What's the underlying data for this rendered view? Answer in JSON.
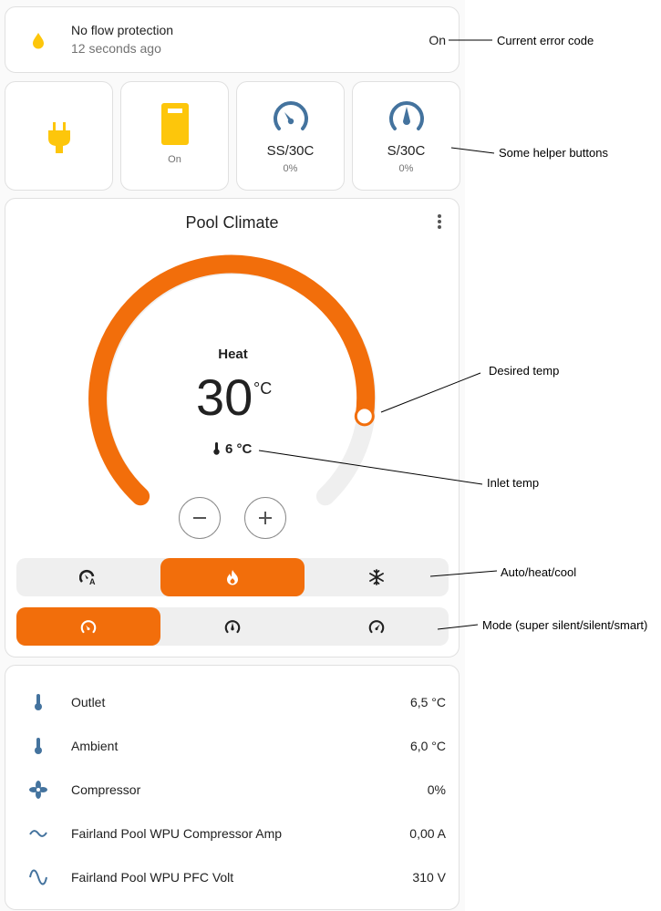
{
  "error_card": {
    "title": "No flow protection",
    "subtitle": "12 seconds ago",
    "state": "On",
    "icon": "water-drop-icon"
  },
  "helpers": [
    {
      "icon": "power-plug-icon",
      "name": "",
      "state": ""
    },
    {
      "icon": "switch-toggle-icon",
      "name": "",
      "state": "On"
    },
    {
      "icon": "gauge-low-icon",
      "name": "SS/30C",
      "state": "0%"
    },
    {
      "icon": "gauge-mid-icon",
      "name": "S/30C",
      "state": "0%"
    }
  ],
  "climate": {
    "title": "Pool Climate",
    "action": "Heat",
    "target": "30",
    "unit": "°C",
    "inlet": "6 °C",
    "hvac_modes": [
      {
        "icon": "thermostat-auto-icon",
        "active": false
      },
      {
        "icon": "fire-icon",
        "active": true
      },
      {
        "icon": "snowflake-icon",
        "active": false
      }
    ],
    "preset_modes": [
      {
        "icon": "gauge-low-icon",
        "active": true
      },
      {
        "icon": "gauge-mid-icon",
        "active": false
      },
      {
        "icon": "gauge-high-icon",
        "active": false
      }
    ]
  },
  "sensors": [
    {
      "icon": "thermometer-icon",
      "label": "Outlet",
      "value": "6,5 °C"
    },
    {
      "icon": "thermometer-icon",
      "label": "Ambient",
      "value": "6,0 °C"
    },
    {
      "icon": "fan-icon",
      "label": "Compressor",
      "value": "0%"
    },
    {
      "icon": "current-ac-icon",
      "label": "Fairland Pool WPU Compressor Amp",
      "value": "0,00 A"
    },
    {
      "icon": "sine-wave-icon",
      "label": "Fairland Pool WPU PFC Volt",
      "value": "310 V"
    }
  ],
  "annotations": {
    "error_code": "Current error code",
    "helper_buttons": "Some helper buttons",
    "desired_temp": "Desired temp",
    "inlet_temp": "Inlet temp",
    "auto_heat_cool": "Auto/heat/cool",
    "mode": "Mode (super silent/silent/smart)"
  },
  "colors": {
    "accent": "#f26e0b",
    "icon_blue": "#44739e",
    "icon_yellow": "#fdc60b",
    "track": "#efefef"
  }
}
